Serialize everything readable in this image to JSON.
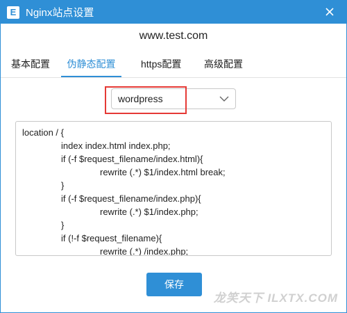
{
  "window": {
    "title": "Nginx站点设置",
    "app_icon_letter": "E"
  },
  "site": {
    "domain": "www.test.com"
  },
  "tabs": [
    {
      "label": "基本配置",
      "active": false
    },
    {
      "label": "伪静态配置",
      "active": true
    },
    {
      "label": "https配置",
      "active": false
    },
    {
      "label": "高级配置",
      "active": false
    }
  ],
  "rewrite": {
    "selected_rule": "wordpress",
    "code_lines": [
      "location / {",
      "index index.html index.php;",
      "if (-f $request_filename/index.html){",
      "rewrite (.*) $1/index.html break;",
      "}",
      "if (-f $request_filename/index.php){",
      "rewrite (.*) $1/index.php;",
      "}",
      "if (!-f $request_filename){",
      "rewrite (.*) /index.php;"
    ]
  },
  "actions": {
    "save_label": "保存"
  },
  "watermark": {
    "text": "龙笑天下 ILXTX.COM"
  },
  "colors": {
    "accent": "#2f8fd6",
    "highlight": "#e53935"
  },
  "icons": {
    "close": "close-icon",
    "dropdown": "chevron-down-icon"
  }
}
